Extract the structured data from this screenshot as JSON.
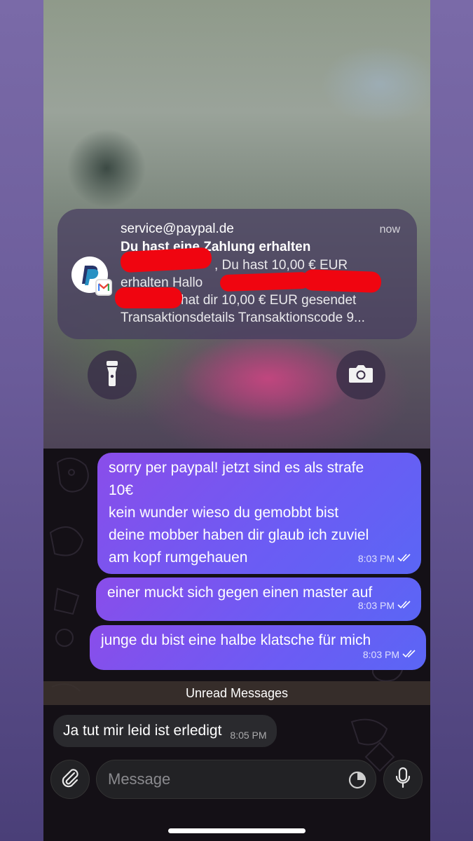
{
  "notification": {
    "sender": "service@paypal.de",
    "time": "now",
    "title": "Du hast eine Zahlung erhalten",
    "line1": ", Du hast 10,00 € EUR",
    "line2": "erhalten Hallo",
    "line3": "hat dir 10,00 € EUR gesendet",
    "line4": "Transaktionsdetails Transaktionscode 9...",
    "app_icon": "paypal-icon",
    "badge_icon": "gmail-icon"
  },
  "lockscreen": {
    "left_button_icon": "flashlight-icon",
    "right_button_icon": "camera-icon"
  },
  "messages": [
    {
      "lines": [
        "sorry per paypal! jetzt sind es als strafe",
        "10€",
        "kein wunder wieso du gemobbt bist",
        "deine mobber haben dir glaub ich zuviel",
        "am kopf rumgehauen"
      ],
      "time": "8:03 PM"
    },
    {
      "lines": [
        "einer muckt sich gegen einen master auf"
      ],
      "time": "8:03 PM"
    },
    {
      "lines": [
        "junge du bist eine halbe klatsche für mich"
      ],
      "time": "8:03 PM"
    }
  ],
  "unread_label": "Unread Messages",
  "incoming": {
    "text": "Ja tut mir leid ist erledigt",
    "time": "8:05 PM"
  },
  "composer": {
    "placeholder": "Message",
    "attach_icon": "paperclip-icon",
    "sticker_icon": "sticker-icon",
    "mic_icon": "microphone-icon"
  },
  "colors": {
    "outgoing_bubble": "#7a55ef",
    "redaction": "#f00510",
    "chat_background": "#141016"
  }
}
